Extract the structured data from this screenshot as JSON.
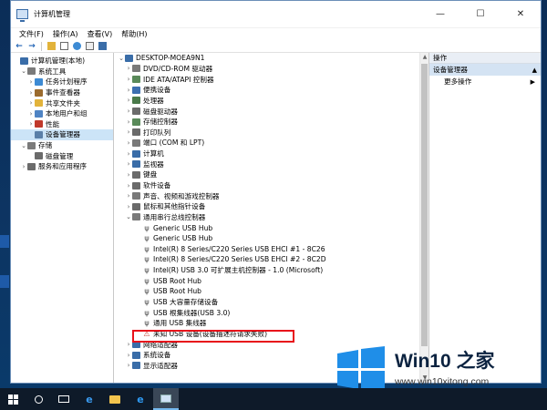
{
  "window": {
    "title": "计算机管理",
    "controls": {
      "minimize": "—",
      "maximize": "☐",
      "close": "✕"
    }
  },
  "menu": [
    "文件(F)",
    "操作(A)",
    "查看(V)",
    "帮助(H)"
  ],
  "left_tree": [
    {
      "label": "计算机管理(本地)",
      "depth": 0,
      "expander": "",
      "icon": "computer-icon",
      "color": "#3a6da8"
    },
    {
      "label": "系统工具",
      "depth": 1,
      "expander": "v",
      "icon": "tools-icon",
      "color": "#7a7a7a"
    },
    {
      "label": "任务计划程序",
      "depth": 2,
      "expander": ">",
      "icon": "clock-icon",
      "color": "#3d8bd4"
    },
    {
      "label": "事件查看器",
      "depth": 2,
      "expander": ">",
      "icon": "event-icon",
      "color": "#9b6b2e"
    },
    {
      "label": "共享文件夹",
      "depth": 2,
      "expander": ">",
      "icon": "folder-icon",
      "color": "#e2b33b"
    },
    {
      "label": "本地用户和组",
      "depth": 2,
      "expander": ">",
      "icon": "users-icon",
      "color": "#4f84c4"
    },
    {
      "label": "性能",
      "depth": 2,
      "expander": ">",
      "icon": "performance-icon",
      "color": "#c0392b"
    },
    {
      "label": "设备管理器",
      "depth": 2,
      "expander": "",
      "icon": "device-manager-icon",
      "color": "#5a7fa8",
      "selected": true
    },
    {
      "label": "存储",
      "depth": 1,
      "expander": "v",
      "icon": "storage-icon",
      "color": "#7a7a7a"
    },
    {
      "label": "磁盘管理",
      "depth": 2,
      "expander": "",
      "icon": "disk-icon",
      "color": "#6b6b6b"
    },
    {
      "label": "服务和应用程序",
      "depth": 1,
      "expander": ">",
      "icon": "services-icon",
      "color": "#6b6b6b"
    }
  ],
  "device_tree": {
    "root": "DESKTOP-MOEA9N1",
    "categories_top": [
      {
        "label": "DVD/CD-ROM 驱动器",
        "icon": "dvd-icon",
        "color": "#7a7a7a"
      },
      {
        "label": "IDE ATA/ATAPI 控制器",
        "icon": "ide-icon",
        "color": "#5a8a5a"
      },
      {
        "label": "便携设备",
        "icon": "portable-icon",
        "color": "#3d6fb0"
      },
      {
        "label": "处理器",
        "icon": "cpu-icon",
        "color": "#4a7a4a"
      },
      {
        "label": "磁盘驱动器",
        "icon": "disk-drive-icon",
        "color": "#6b6b6b"
      },
      {
        "label": "存储控制器",
        "icon": "storage-controller-icon",
        "color": "#5a8a5a"
      },
      {
        "label": "打印队列",
        "icon": "printer-icon",
        "color": "#6b6b6b"
      },
      {
        "label": "端口 (COM 和 LPT)",
        "icon": "port-icon",
        "color": "#7a7a7a"
      },
      {
        "label": "计算机",
        "icon": "computer-icon",
        "color": "#3a6da8"
      },
      {
        "label": "监视器",
        "icon": "monitor-icon",
        "color": "#3a6da8"
      },
      {
        "label": "键盘",
        "icon": "keyboard-icon",
        "color": "#6b6b6b"
      },
      {
        "label": "软件设备",
        "icon": "software-icon",
        "color": "#6b6b6b"
      },
      {
        "label": "声音、视频和游戏控制器",
        "icon": "sound-icon",
        "color": "#7a7a7a"
      },
      {
        "label": "鼠标和其他指针设备",
        "icon": "mouse-icon",
        "color": "#6b6b6b"
      }
    ],
    "usb_category": "通用串行总线控制器",
    "usb_devices": [
      "Generic USB Hub",
      "Generic USB Hub",
      "Intel(R) 8 Series/C220 Series USB EHCI #1 - 8C26",
      "Intel(R) 8 Series/C220 Series USB EHCI #2 - 8C2D",
      "Intel(R) USB 3.0 可扩展主机控制器 - 1.0 (Microsoft)",
      "USB Root Hub",
      "USB Root Hub",
      "USB 大容量存储设备",
      "USB 根集线器(USB 3.0)",
      "通用 USB 集线器"
    ],
    "unknown_device": "未知 USB 设备(设备描述符请求失败)",
    "categories_bottom": [
      {
        "label": "网络适配器",
        "icon": "network-icon",
        "color": "#3a6da8"
      },
      {
        "label": "系统设备",
        "icon": "system-device-icon",
        "color": "#3a6da8"
      },
      {
        "label": "显示适配器",
        "icon": "display-adapter-icon",
        "color": "#3a6da8"
      }
    ]
  },
  "actions": {
    "header": "操作",
    "section": "设备管理器",
    "item": "更多操作"
  },
  "watermark": {
    "title": "Win10 之家",
    "url": "www.win10xitong.com"
  }
}
